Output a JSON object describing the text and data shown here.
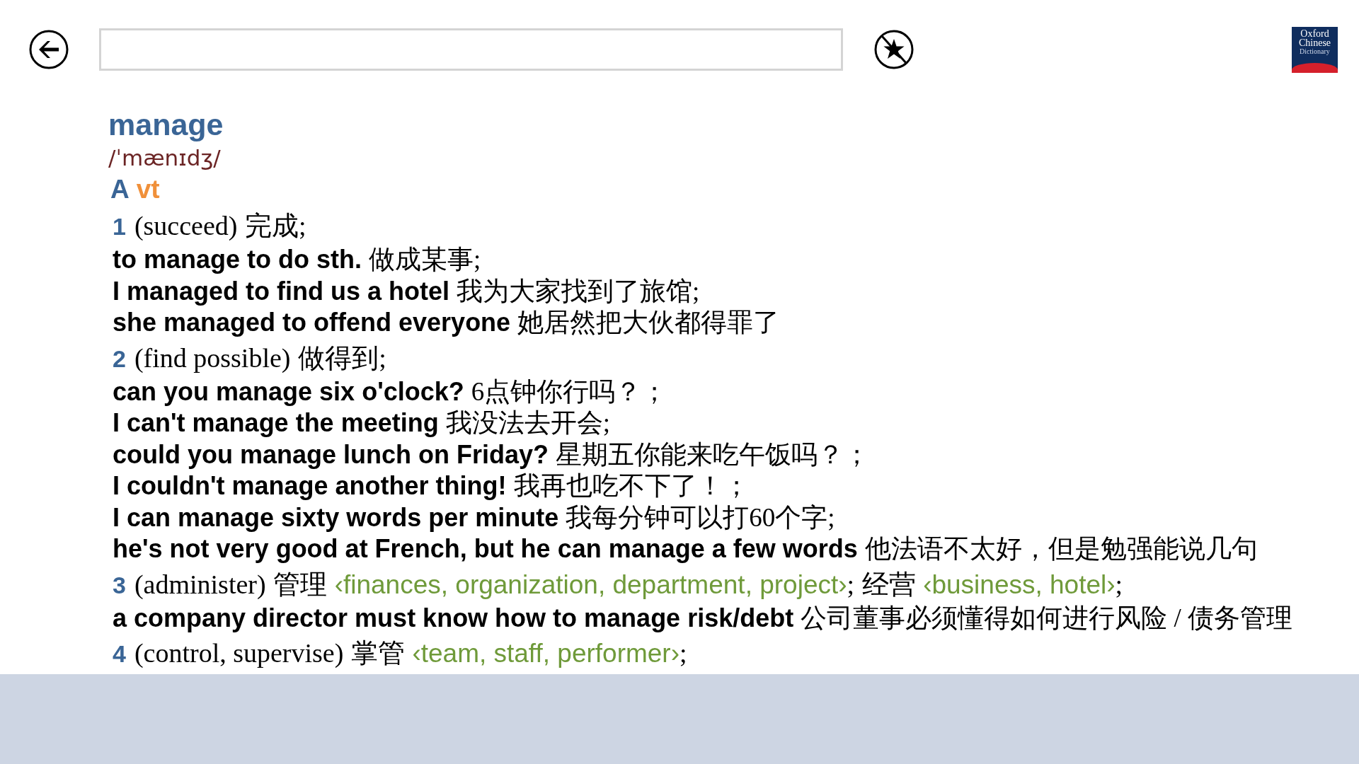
{
  "logo": {
    "lines": [
      "Oxford",
      "Chinese",
      "Dictionary"
    ]
  },
  "entry": {
    "headword": "manage",
    "pronunciation": "/ˈmænɪdʒ/",
    "section": "A",
    "part_of_speech": "vt",
    "senses": [
      {
        "number": "1",
        "parts": [
          {
            "kind": "gloss",
            "text": "(succeed)"
          },
          {
            "kind": "zh",
            "text": "完成"
          },
          {
            "kind": "punct",
            "text": ";"
          }
        ],
        "examples": [
          {
            "en": "to manage to do sth.",
            "zh": "做成某事;"
          },
          {
            "en": "I managed to find us a hotel",
            "zh": "我为大家找到了旅馆;"
          },
          {
            "en": "she managed to offend everyone",
            "zh": "她居然把大伙都得罪了"
          }
        ]
      },
      {
        "number": "2",
        "parts": [
          {
            "kind": "gloss",
            "text": "(find possible)"
          },
          {
            "kind": "zh",
            "text": "做得到"
          },
          {
            "kind": "punct",
            "text": ";"
          }
        ],
        "examples": [
          {
            "en": "can you manage six o'clock?",
            "zh": "6点钟你行吗？；"
          },
          {
            "en": "I can't manage the meeting",
            "zh": "我没法去开会;"
          },
          {
            "en": "could you manage lunch on Friday?",
            "zh": "星期五你能来吃午饭吗？；"
          },
          {
            "en": "I couldn't manage another thing!",
            "zh": "我再也吃不下了！；"
          },
          {
            "en": "I can manage sixty words per minute",
            "zh": "我每分钟可以打60个字;"
          },
          {
            "en": "he's not very good at French, but he can manage a few words",
            "zh": "他法语不太好，但是勉强能说几句"
          }
        ]
      },
      {
        "number": "3",
        "parts": [
          {
            "kind": "gloss",
            "text": "(administer)"
          },
          {
            "kind": "zh",
            "text": "管理"
          },
          {
            "kind": "collocate",
            "text": "‹finances, organization, department, project›"
          },
          {
            "kind": "punct",
            "text": ";"
          },
          {
            "kind": "zh",
            "text": "经营"
          },
          {
            "kind": "collocate",
            "text": "‹business, hotel›"
          },
          {
            "kind": "punct",
            "text": ";"
          }
        ],
        "examples": [
          {
            "en": "a company director must know how to manage risk/debt",
            "zh": "公司董事必须懂得如何进行风险 / 债务管理"
          }
        ]
      },
      {
        "number": "4",
        "parts": [
          {
            "kind": "gloss",
            "text": "(control, supervise)"
          },
          {
            "kind": "zh",
            "text": "掌管"
          },
          {
            "kind": "collocate",
            "text": "‹team, staff, performer›"
          },
          {
            "kind": "punct",
            "text": ";"
          }
        ]
      }
    ]
  }
}
